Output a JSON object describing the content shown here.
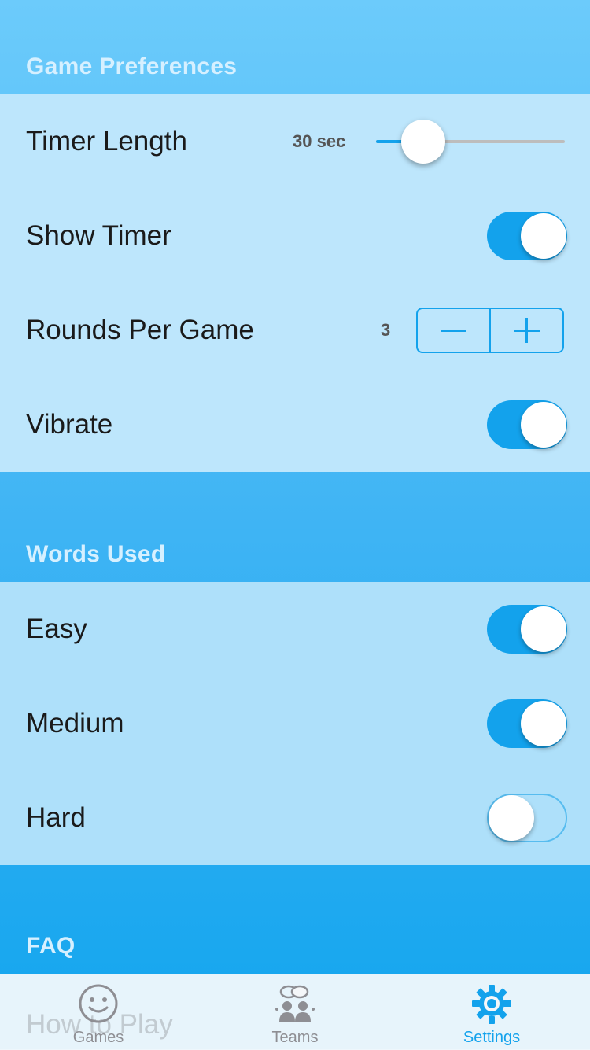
{
  "colors": {
    "accent": "#13a2ec",
    "row_background": "#b8e4fb",
    "header_text": "#d6f0ff"
  },
  "sections": {
    "game_preferences": "Game Preferences",
    "words_used": "Words Used",
    "faq": "FAQ"
  },
  "game_preferences": {
    "timer_length": {
      "label": "Timer Length",
      "value_text": "30 sec",
      "slider_fraction": 0.25
    },
    "show_timer": {
      "label": "Show Timer",
      "on": true
    },
    "rounds_per_game": {
      "label": "Rounds Per Game",
      "value": "3"
    },
    "vibrate": {
      "label": "Vibrate",
      "on": true
    }
  },
  "words_used": {
    "easy": {
      "label": "Easy",
      "on": true
    },
    "medium": {
      "label": "Medium",
      "on": true
    },
    "hard": {
      "label": "Hard",
      "on": false
    }
  },
  "faq": {
    "first_item": "How to Play"
  },
  "tabbar": {
    "tabs": [
      {
        "label": "Games",
        "icon": "smiley-icon",
        "active": false
      },
      {
        "label": "Teams",
        "icon": "people-chat-icon",
        "active": false
      },
      {
        "label": "Settings",
        "icon": "gear-icon",
        "active": true
      }
    ]
  }
}
